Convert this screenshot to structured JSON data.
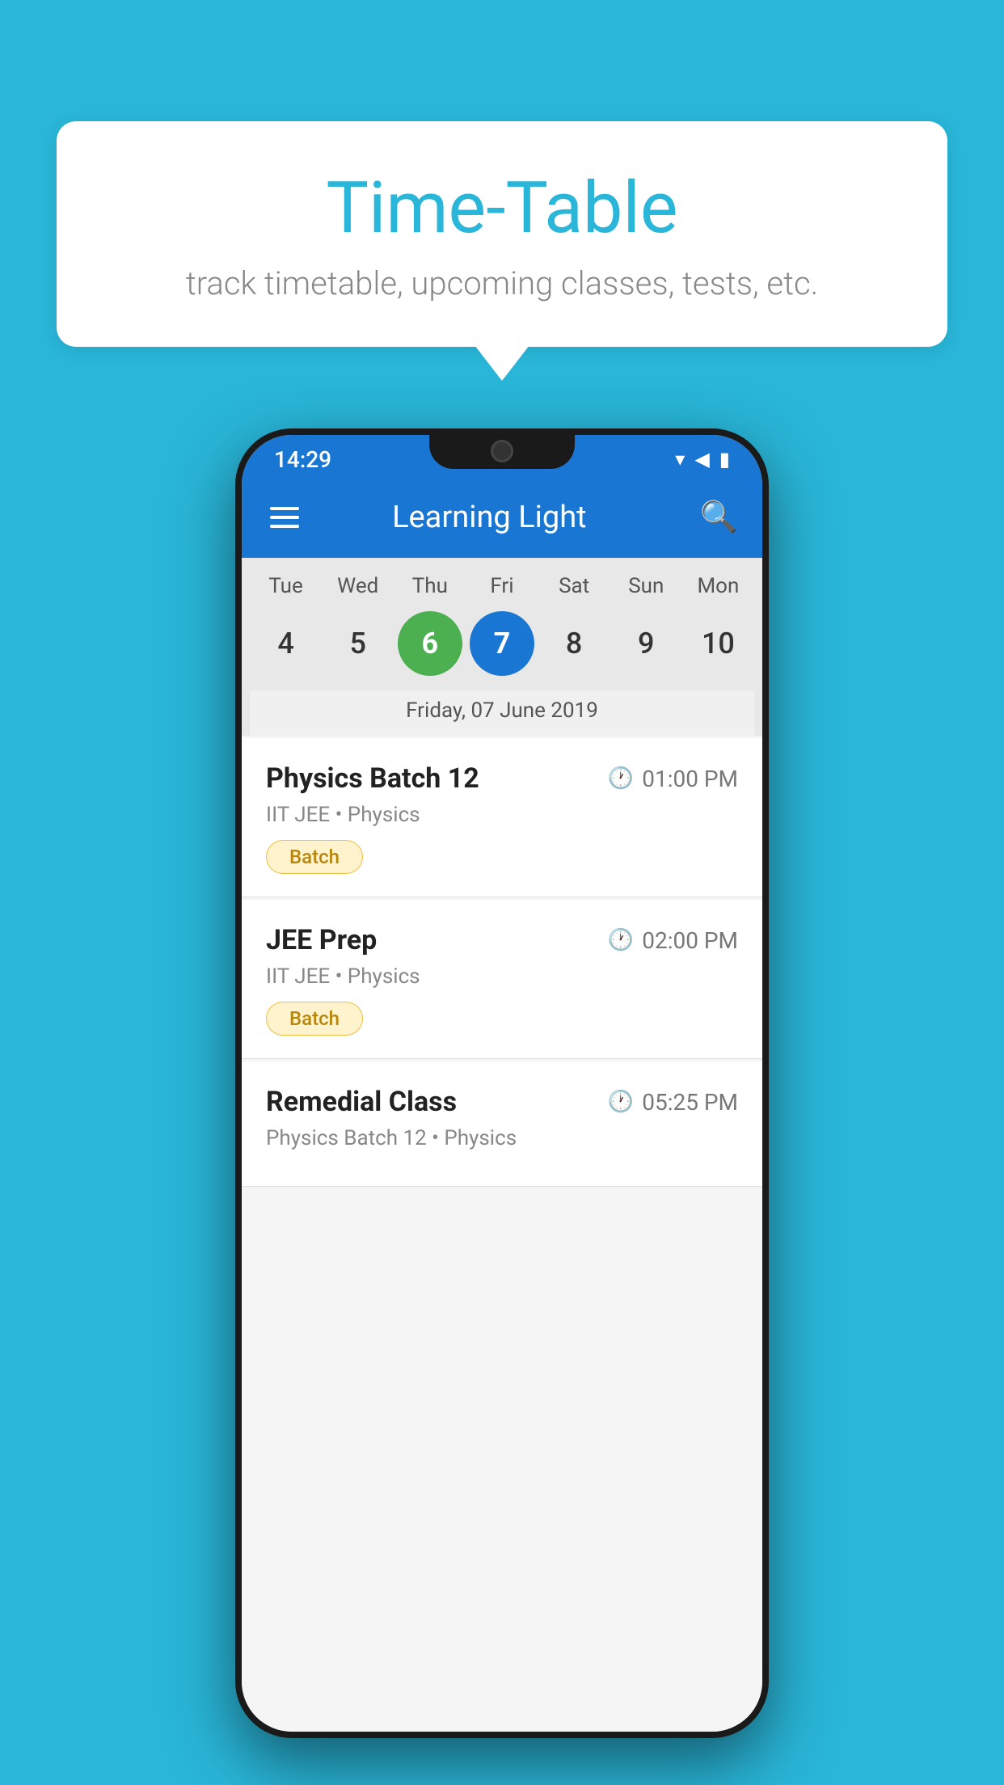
{
  "background_color": "#29B6D8",
  "speech_bubble": {
    "title": "Time-Table",
    "subtitle": "track timetable, upcoming classes, tests, etc."
  },
  "phone": {
    "status_bar": {
      "time": "14:29"
    },
    "app_bar": {
      "title": "Learning Light"
    },
    "calendar": {
      "days": [
        {
          "label": "Tue",
          "number": "4",
          "state": "normal"
        },
        {
          "label": "Wed",
          "number": "5",
          "state": "normal"
        },
        {
          "label": "Thu",
          "number": "6",
          "state": "today"
        },
        {
          "label": "Fri",
          "number": "7",
          "state": "selected"
        },
        {
          "label": "Sat",
          "number": "8",
          "state": "normal"
        },
        {
          "label": "Sun",
          "number": "9",
          "state": "normal"
        },
        {
          "label": "Mon",
          "number": "10",
          "state": "normal"
        }
      ],
      "selected_date_label": "Friday, 07 June 2019"
    },
    "schedule": [
      {
        "title": "Physics Batch 12",
        "time": "01:00 PM",
        "subtitle": "IIT JEE • Physics",
        "tag": "Batch"
      },
      {
        "title": "JEE Prep",
        "time": "02:00 PM",
        "subtitle": "IIT JEE • Physics",
        "tag": "Batch"
      },
      {
        "title": "Remedial Class",
        "time": "05:25 PM",
        "subtitle": "Physics Batch 12 • Physics",
        "tag": null
      }
    ]
  },
  "icons": {
    "hamburger": "hamburger-icon",
    "search": "🔍",
    "clock": "🕐"
  }
}
